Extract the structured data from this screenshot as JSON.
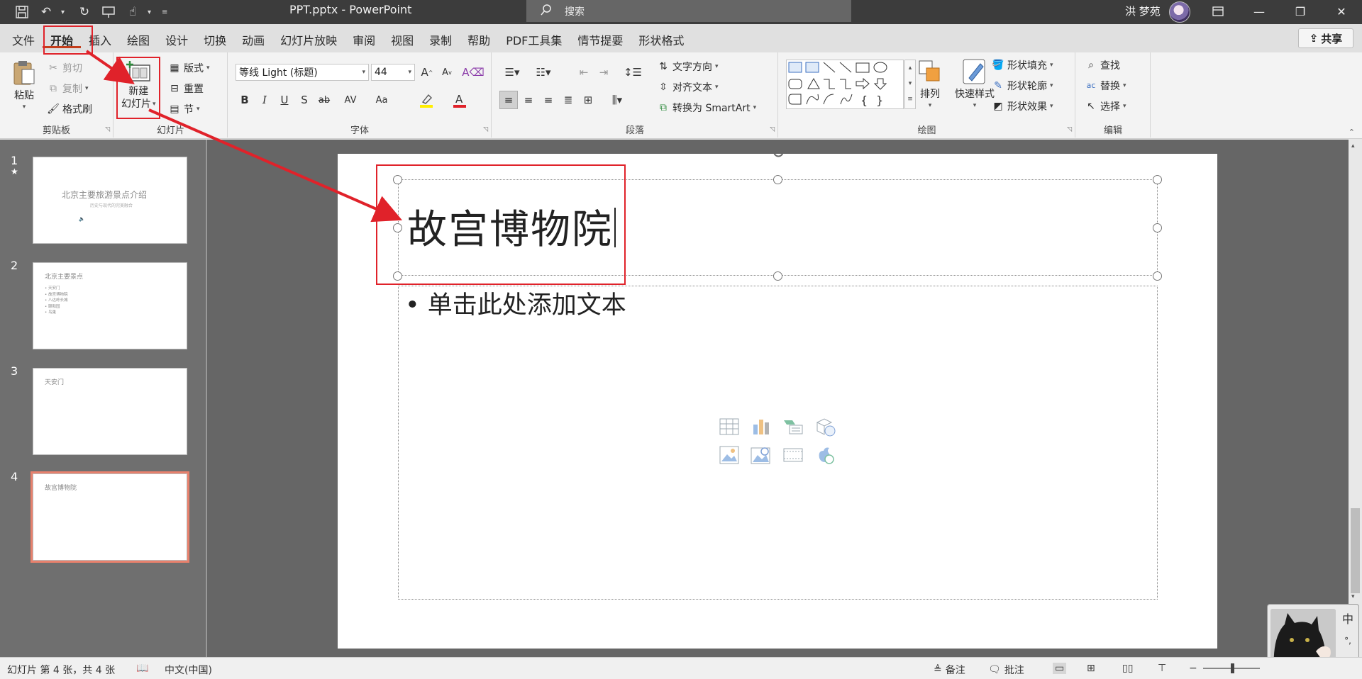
{
  "titlebar": {
    "document_title": "PPT.pptx  -  PowerPoint",
    "search_placeholder": "搜索",
    "user_name": "洪 梦苑"
  },
  "tabs": [
    "文件",
    "开始",
    "插入",
    "绘图",
    "设计",
    "切换",
    "动画",
    "幻灯片放映",
    "审阅",
    "视图",
    "录制",
    "帮助",
    "PDF工具集",
    "情节提要",
    "形状格式"
  ],
  "active_tab": "开始",
  "share_label": "共享",
  "clipboard": {
    "paste": "粘贴",
    "cut": "剪切",
    "copy": "复制",
    "format_painter": "格式刷",
    "group_label": "剪贴板"
  },
  "slides_group": {
    "new_slide_line1": "新建",
    "new_slide_line2": "幻灯片",
    "layout": "版式",
    "reset": "重置",
    "section": "节",
    "group_label": "幻灯片"
  },
  "font": {
    "font_name": "等线 Light (标题)",
    "font_size": "44",
    "bold": "B",
    "italic": "I",
    "underline": "U",
    "shadow": "S",
    "strikethrough": "ab",
    "spacing": "AV",
    "change_case": "Aa",
    "group_label": "字体"
  },
  "paragraph": {
    "text_direction": "文字方向",
    "align_text": "对齐文本",
    "convert_smartart": "转换为 SmartArt",
    "group_label": "段落"
  },
  "drawing": {
    "arrange": "排列",
    "quick_styles": "快速样式",
    "shape_fill": "形状填充",
    "shape_outline": "形状轮廓",
    "shape_effects": "形状效果",
    "group_label": "绘图"
  },
  "editing": {
    "find": "查找",
    "replace": "替换",
    "select": "选择",
    "group_label": "编辑"
  },
  "thumbnails": [
    {
      "number": "1",
      "star": "★",
      "title": "北京主要旅游景点介绍",
      "subtitle": "历史与现代的完美融合"
    },
    {
      "number": "2",
      "title": "北京主要景点",
      "items": [
        "• 天安门",
        "• 故宫博物院",
        "• 八达岭长城",
        "• 颐和园",
        "• 鸟巢"
      ]
    },
    {
      "number": "3",
      "title": "天安门"
    },
    {
      "number": "4",
      "title": "故宫博物院"
    }
  ],
  "slide": {
    "title": "故宫博物院",
    "body_placeholder": "• 单击此处添加文本"
  },
  "statusbar": {
    "slide_info": "幻灯片 第 4 张，共 4 张",
    "language": "中文(中国)",
    "notes": "备注",
    "comments": "批注"
  },
  "ime": {
    "mode": "中",
    "punct": "°,",
    "skin": "👕"
  },
  "colors": {
    "accent": "#c43e1c",
    "annotation_red": "#e0222a",
    "thumb_selected": "#e8816d"
  }
}
